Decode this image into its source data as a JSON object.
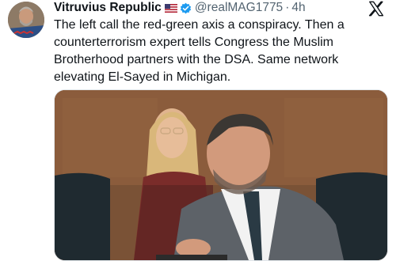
{
  "post": {
    "display_name": "Vitruvius Republic",
    "handle": "@realMAG1775",
    "separator": "·",
    "timestamp": "4h",
    "text_lines": [
      "The left call the red-green axis a conspiracy. Then a",
      "counterterrorism expert tells Congress the Muslim",
      "Brotherhood partners with the DSA. Same network",
      "elevating El-Sayed in Michigan."
    ]
  },
  "icons": {
    "flag": "us-flag-icon",
    "verified": "verified-badge-icon",
    "platform": "x-logo-icon"
  },
  "colors": {
    "text": "#0f1419",
    "muted": "#536471",
    "verified": "#1d9bf0"
  }
}
